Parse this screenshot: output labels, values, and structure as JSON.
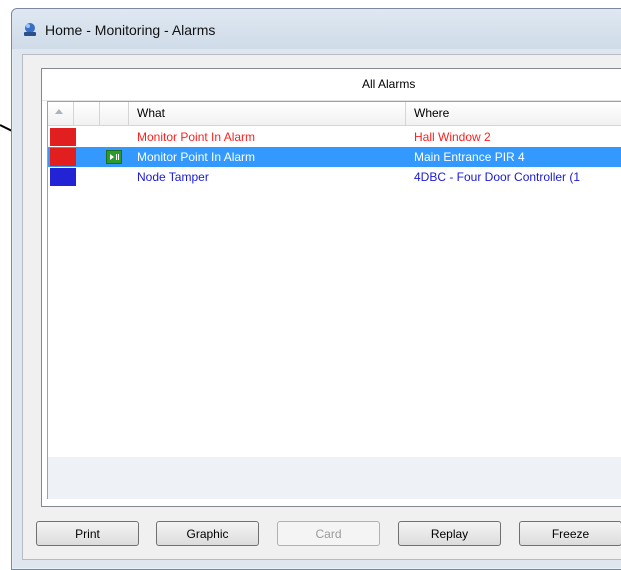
{
  "window": {
    "title": "Home - Monitoring - Alarms"
  },
  "panel": {
    "title": "All Alarms"
  },
  "columns": {
    "what": "What",
    "where": "Where"
  },
  "rows": [
    {
      "what": "Monitor Point In Alarm",
      "where": "Hall Window 2",
      "color": "#ff2020",
      "priority_color": "#e21f1f",
      "selected": false
    },
    {
      "what": "Monitor Point In Alarm",
      "where": "Main Entrance PIR 4",
      "color": "#ffffff",
      "priority_color": "#e21f1f",
      "selected": true
    },
    {
      "what": "Node Tamper",
      "where": "4DBC - Four Door Controller (1",
      "color": "#1a1ad6",
      "priority_color": "#2323d6",
      "selected": false
    }
  ],
  "buttons": {
    "print": "Print",
    "graphic": "Graphic",
    "card": "Card",
    "replay": "Replay",
    "freeze": "Freeze"
  }
}
